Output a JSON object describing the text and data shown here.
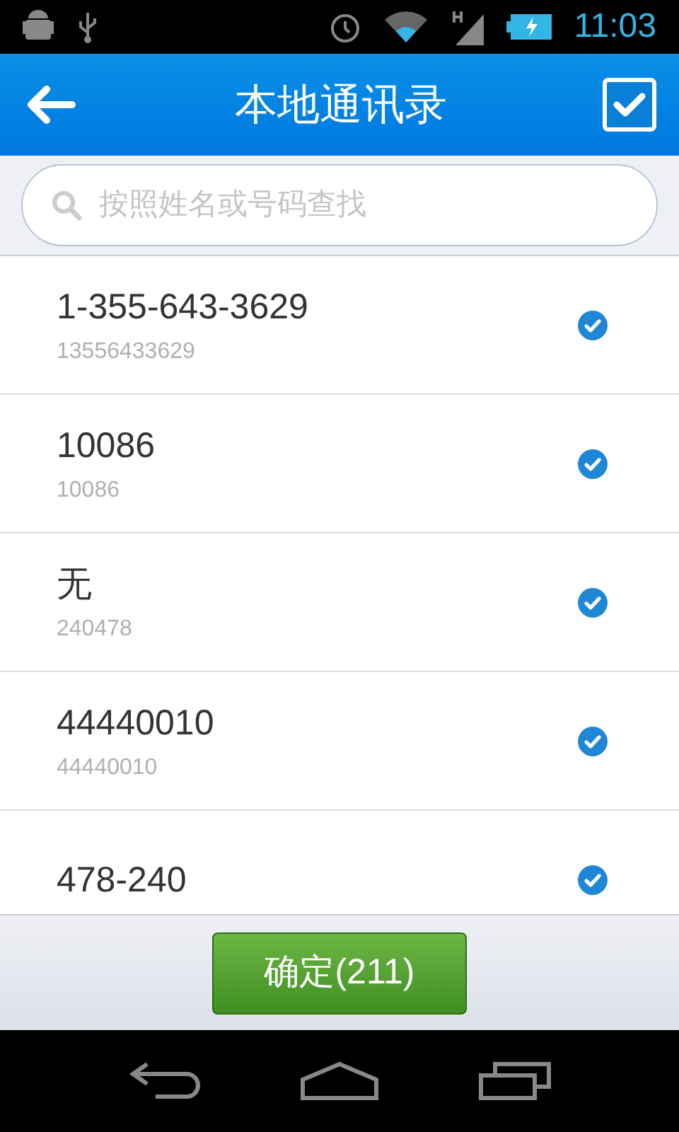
{
  "status_bar": {
    "time": "11:03"
  },
  "header": {
    "title": "本地通讯录",
    "select_all": true
  },
  "search": {
    "placeholder": "按照姓名或号码查找"
  },
  "contacts": [
    {
      "name": "1-355-643-3629",
      "number": "13556433629",
      "checked": true
    },
    {
      "name": "10086",
      "number": "10086",
      "checked": true
    },
    {
      "name": "无",
      "number": "240478",
      "checked": true
    },
    {
      "name": "44440010",
      "number": "44440010",
      "checked": true
    },
    {
      "name": "478-240",
      "checked": true
    }
  ],
  "confirm_button": {
    "label": "确定(211)"
  }
}
